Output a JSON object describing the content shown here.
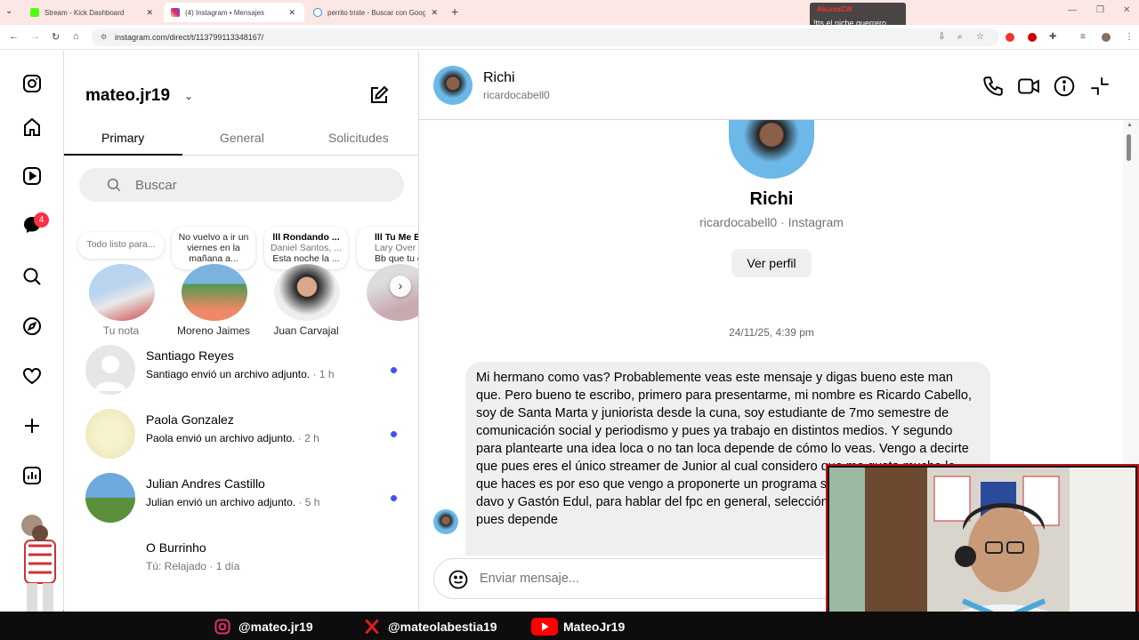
{
  "browser": {
    "tabs": [
      {
        "title": "Stream - Kick Dashboard",
        "favicon_color": "#53fc18"
      },
      {
        "title": "(4) Instagram • Mensajes",
        "favicon_color": "#d6249f"
      },
      {
        "title": "perrito triste - Buscar con Goog",
        "favicon_color": "#4285f4"
      }
    ],
    "new_tab": "+",
    "url": "instagram.com/direct/t/113799113348167/"
  },
  "stream_overlay": {
    "top_label": "AkumaCW",
    "bottom_label": "!tts el niche guerrero"
  },
  "rail": {
    "notifications_badge": "4"
  },
  "list": {
    "username": "mateo.jr19",
    "tabs": [
      "Primary",
      "General",
      "Solicitudes"
    ],
    "search_placeholder": "Buscar",
    "notes": [
      {
        "bubble": "Todo listo para...",
        "name": "Tu nota",
        "avatar_color": "#b8d4ee"
      },
      {
        "bubble": "No vuelvo a ir un viernes en la mañana a...",
        "name": "Moreno Jaimes",
        "avatar_color": "#6fa86a"
      },
      {
        "bubble_title": "lll Rondando ...",
        "bubble_sub1": "Daniel Santos, ...",
        "bubble_sub2": "Esta noche la ...",
        "name": "Juan Carvajal",
        "avatar_color": "#3b3b3b"
      },
      {
        "bubble_title": "lll Tu Me E...",
        "bubble_sub1": "Lary Over",
        "bubble_sub2": "Bb que tu c",
        "name": "",
        "avatar_color": "#c9aab0"
      }
    ],
    "conversations": [
      {
        "name": "Santiago Reyes",
        "preview": "Santiago envió un archivo adjunto.",
        "time": "· 1 h",
        "unread": true,
        "avatar_color": "#e0e0e0"
      },
      {
        "name": "Paola Gonzalez",
        "preview": "Paola envió un archivo adjunto.",
        "time": "· 2 h",
        "unread": true,
        "avatar_color": "#f2edc6"
      },
      {
        "name": "Julian Andres Castillo",
        "preview": "Julian envió un archivo adjunto.",
        "time": "· 5 h",
        "unread": true,
        "avatar_color": "#7ba7c9"
      },
      {
        "name": "O Burrinho",
        "preview": "Tú: Relajado",
        "time": "· 1 día",
        "unread": false,
        "avatar_color": "#d9c6a5"
      }
    ]
  },
  "chat": {
    "name": "Richi",
    "handle": "ricardocabell0",
    "profile_sub": "ricardocabell0 · Instagram",
    "view_profile": "Ver perfil",
    "timestamp": "24/11/25, 4:39 pm",
    "message": "Mi hermano como vas? Probablemente veas este mensaje y digas bueno este man que. Pero bueno te escribo, primero para presentarme, mi nombre es Ricardo Cabello, soy de Santa Marta y juniorista desde la cuna, soy estudiante de 7mo semestre de comunicación social y periodismo y pues ya trabajo en distintos medios. Y segundo para plantearte una idea loca o no tan loca depende de cómo lo veas. Vengo a decirte que pues eres el único streamer de Junior al cual considero que me gusta mucho lo que haces es por eso que vengo a proponerte un programa semanal así como lo hacen davo y Gastón Edul, para hablar del fpc en general, selección y fútbol internacional pues depende",
    "composer_placeholder": "Enviar mensaje..."
  },
  "socials": [
    {
      "handle": "@mateo.jr19",
      "icon": "instagram-icon",
      "color": "#e1306c"
    },
    {
      "handle": "@mateolabestia19",
      "icon": "x-icon",
      "color": "#e01b1b"
    },
    {
      "handle": "MateoJr19",
      "icon": "youtube-icon",
      "color": "#ff0000"
    }
  ]
}
